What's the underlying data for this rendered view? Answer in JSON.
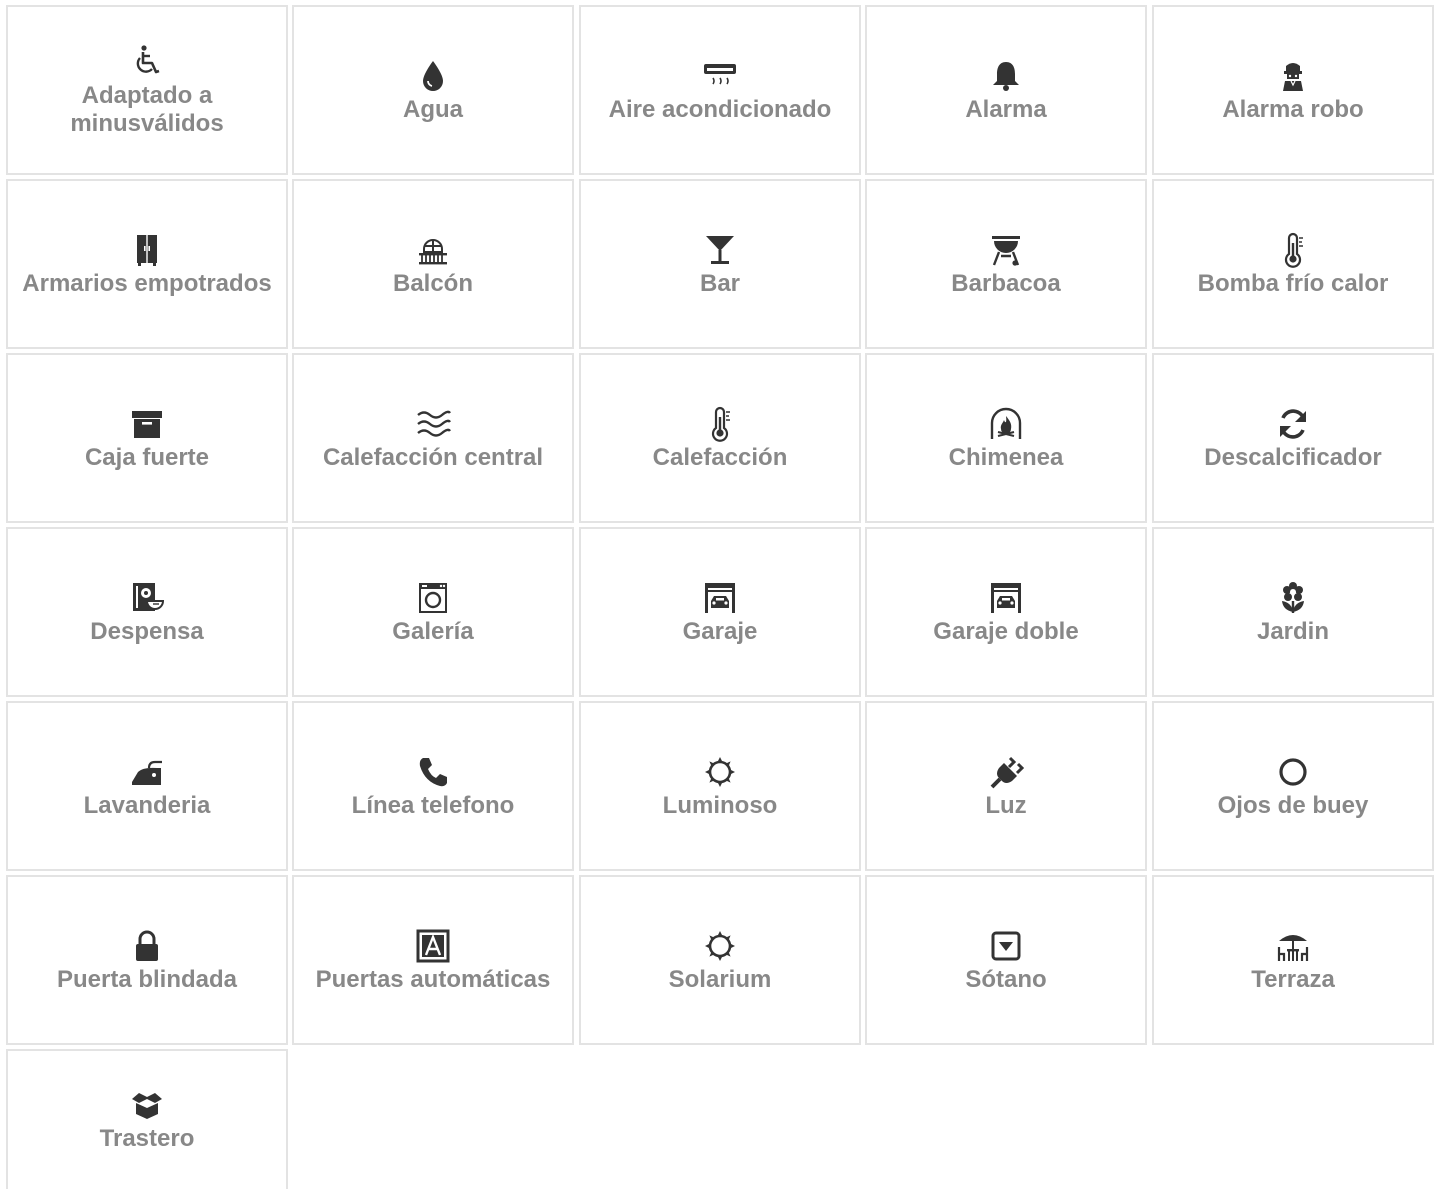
{
  "icon_color": "#333333",
  "label_color": "#888888",
  "border_color": "#e3e3e3",
  "features": [
    {
      "label": "Adaptado a minusválidos",
      "icon": "wheelchair-icon"
    },
    {
      "label": "Agua",
      "icon": "water-drop-icon"
    },
    {
      "label": "Aire acondicionado",
      "icon": "air-conditioner-icon"
    },
    {
      "label": "Alarma",
      "icon": "bell-icon"
    },
    {
      "label": "Alarma robo",
      "icon": "burglar-icon"
    },
    {
      "label": "Armarios empotrados",
      "icon": "wardrobe-icon"
    },
    {
      "label": "Balcón",
      "icon": "balcony-icon"
    },
    {
      "label": "Bar",
      "icon": "cocktail-glass-icon"
    },
    {
      "label": "Barbacoa",
      "icon": "grill-icon"
    },
    {
      "label": "Bomba frío calor",
      "icon": "thermometer-icon"
    },
    {
      "label": "Caja fuerte",
      "icon": "archive-box-icon"
    },
    {
      "label": "Calefacción central",
      "icon": "heat-waves-icon"
    },
    {
      "label": "Calefacción",
      "icon": "thermometer-icon"
    },
    {
      "label": "Chimenea",
      "icon": "fireplace-icon"
    },
    {
      "label": "Descalcificador",
      "icon": "refresh-icon"
    },
    {
      "label": "Despensa",
      "icon": "pantry-icon"
    },
    {
      "label": "Galería",
      "icon": "washing-machine-icon"
    },
    {
      "label": "Garaje",
      "icon": "garage-icon"
    },
    {
      "label": "Garaje doble",
      "icon": "garage-icon"
    },
    {
      "label": "Jardin",
      "icon": "flower-icon"
    },
    {
      "label": "Lavanderia",
      "icon": "iron-icon"
    },
    {
      "label": "Línea telefono",
      "icon": "phone-icon"
    },
    {
      "label": "Luminoso",
      "icon": "sun-outline-icon"
    },
    {
      "label": "Luz",
      "icon": "plug-icon"
    },
    {
      "label": "Ojos de buey",
      "icon": "circle-outline-icon"
    },
    {
      "label": "Puerta blindada",
      "icon": "lock-icon"
    },
    {
      "label": "Puertas automáticas",
      "icon": "letter-a-box-icon"
    },
    {
      "label": "Solarium",
      "icon": "sun-outline-icon"
    },
    {
      "label": "Sótano",
      "icon": "caret-square-down-icon"
    },
    {
      "label": "Terraza",
      "icon": "terrace-umbrella-icon"
    },
    {
      "label": "Trastero",
      "icon": "open-box-icon"
    }
  ]
}
